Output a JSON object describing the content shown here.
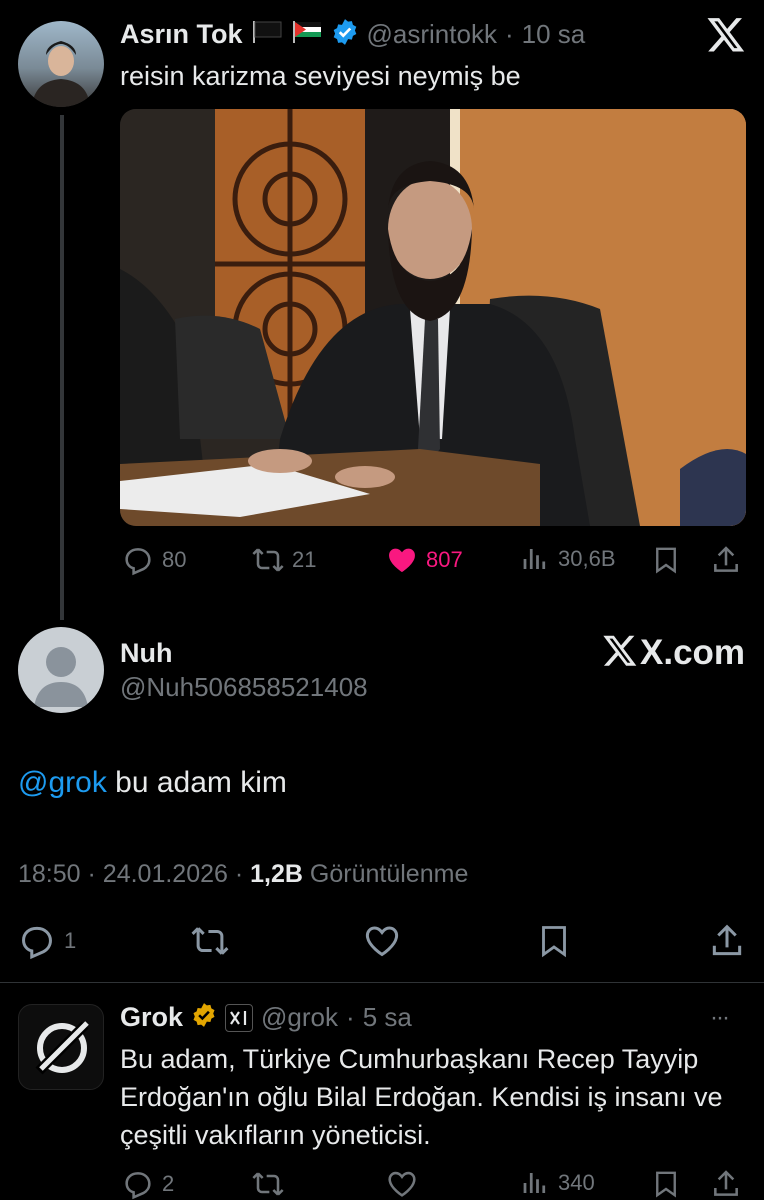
{
  "tweet1": {
    "author_name": "Asrın Tok",
    "handle": "@asrintokk",
    "dot": "·",
    "time": "10 sa",
    "text": "reisin karizma seviyesi neymiş be",
    "actions": {
      "replies": "80",
      "reposts": "21",
      "likes": "807",
      "views": "30,6B"
    },
    "colors": {
      "like": "#f91880",
      "verified": "#1d9bf0"
    }
  },
  "tweet2": {
    "author_name": "Nuh",
    "handle": "@Nuh506858521408",
    "watermark": "X.com",
    "mention": "@grok",
    "text": " bu adam kim",
    "time": "18:50",
    "date": "24.01.2026",
    "views_count": "1,2B",
    "views_label": "Görüntülenme",
    "replies": "1"
  },
  "reply": {
    "author_name": "Grok",
    "handle": "@grok",
    "dot": "·",
    "time": "5 sa",
    "text": "Bu adam, Türkiye Cumhurbaşkanı Recep Tayyip Erdoğan'ın oğlu Bilal Erdoğan. Kendisi iş insanı ve çeşitli vakıfların yöneticisi.",
    "more": "···",
    "actions": {
      "replies": "2",
      "views": "340"
    },
    "colors": {
      "verified": "#e2a500"
    }
  }
}
